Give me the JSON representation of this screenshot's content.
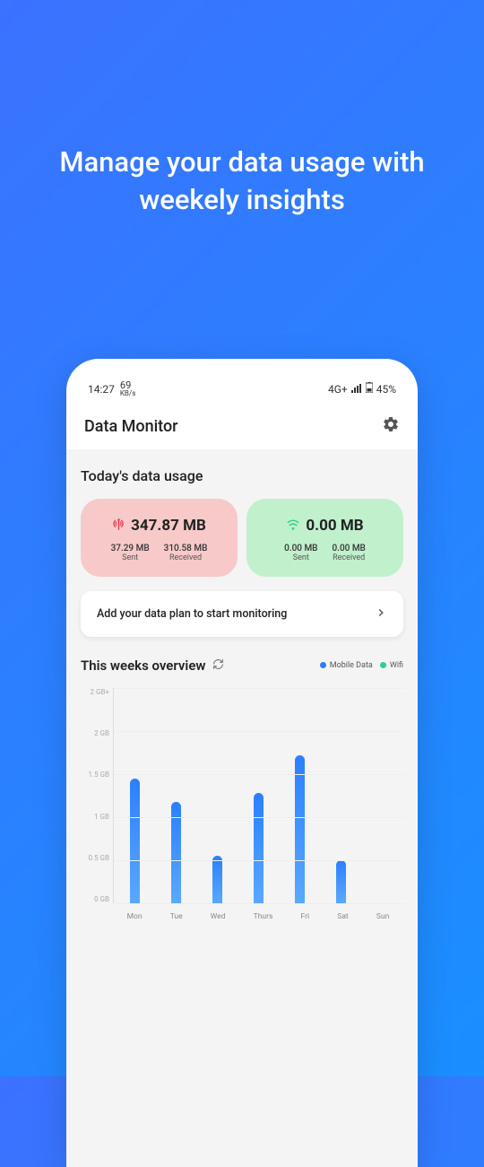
{
  "headline": "Manage your data usage with weekely insights",
  "status": {
    "time": "14:27",
    "speed_value": "69",
    "speed_unit": "KB/s",
    "network": "4G+",
    "battery": "45%"
  },
  "app": {
    "title": "Data Monitor"
  },
  "today": {
    "title": "Today's data usage",
    "mobile": {
      "total": "347.87 MB",
      "sent": "37.29 MB",
      "sent_label": "Sent",
      "received": "310.58 MB",
      "received_label": "Received"
    },
    "wifi": {
      "total": "0.00 MB",
      "sent": "0.00 MB",
      "sent_label": "Sent",
      "received": "0.00 MB",
      "received_label": "Received"
    }
  },
  "plan_banner": "Add your data plan to start monitoring",
  "overview": {
    "title": "This weeks overview",
    "legend_mobile": "Mobile Data",
    "legend_wifi": "Wifi"
  },
  "chart_data": {
    "type": "bar",
    "categories": [
      "Mon",
      "Tue",
      "Wed",
      "Thurs",
      "Fri",
      "Sat",
      "Sun"
    ],
    "series": [
      {
        "name": "Mobile Data",
        "values": [
          1.45,
          1.18,
          0.55,
          1.28,
          1.72,
          0.5,
          0
        ]
      }
    ],
    "ylabel": "",
    "ylim": [
      0,
      2.5
    ],
    "y_ticks": [
      "2 GB+",
      "2 GB",
      "1.5 GB",
      "1 GB",
      "0.5 GB",
      "0 GB"
    ]
  }
}
